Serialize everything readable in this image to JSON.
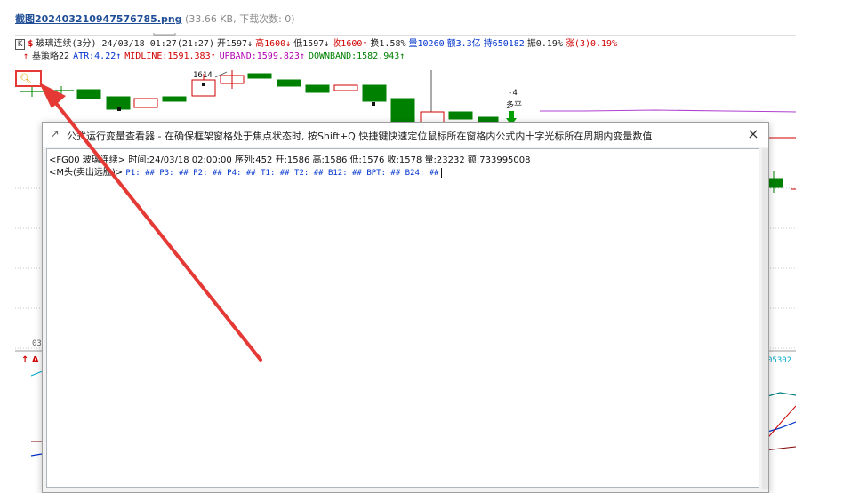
{
  "file": {
    "name": "截图20240321094757678​5.png",
    "meta": "(33.66 KB, 下载次数: 0)"
  },
  "quote": {
    "k": "K",
    "dollar": "$",
    "title": "玻璃连续(3分) 24/03/18 01:27(21:27)",
    "open": "开1597↓",
    "high": "高1600↓",
    "low": "低1597↓",
    "close": "收1600↑",
    "turnover": "换1.58%",
    "volume": "量10260",
    "amount": "额3.3亿",
    "position": "持650182",
    "amplitude": "振0.19%",
    "change": "涨(3)0.19%"
  },
  "strategy": {
    "arrow": "↑",
    "name": "基策略22",
    "atr": "ATR:4.22↑",
    "midline": "MIDLINE:1591.383↑",
    "upband": "UPBAND:1599.823↑",
    "downband": "DOWNBAND:1582.943↑"
  },
  "chart": {
    "price_label": "1614",
    "signal_label_1": "-4",
    "signal_label_2": "多平",
    "axis_left": "03",
    "axis_right": "05302",
    "sub_mark": "↑ A"
  },
  "icons": {
    "magnifier": "magnifier-icon",
    "pin": "pin-icon",
    "close": "close-icon"
  },
  "colors": {
    "up": "#d00000",
    "down": "#008000",
    "highlight": "#e53935",
    "vars": "#0033cc"
  },
  "dialog": {
    "title": "公式运行变量查看器 - 在确保框架窗格处于焦点状态时, 按Shift+Q 快捷键快速定位鼠标所在窗格内公式内十字光标所在周期内变量数值",
    "close": "×",
    "line1": "<FG00 玻璃连续> 时间:24/03/18 02:00:00 序列:452 开:1586 高:1586 低:1576 收:1578 量:23232 额:733995008",
    "line2_prefix": "<M头(卖出远胜)>",
    "line2_vars": "P1: ## P3: ## P2: ## P4: ## T1: ## T2: ## B12: ## BPT: ## B24: ##"
  }
}
